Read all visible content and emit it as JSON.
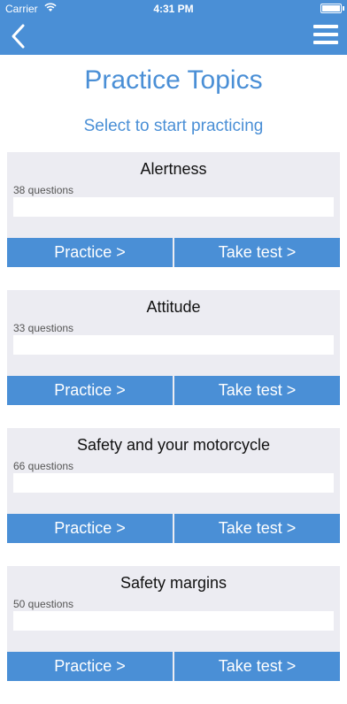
{
  "status_bar": {
    "carrier": "Carrier",
    "time": "4:31 PM"
  },
  "nav": {
    "back_icon": "chevron-left-icon",
    "menu_icon": "hamburger-menu-icon"
  },
  "header": {
    "title": "Practice Topics",
    "subtitle": "Select to start practicing"
  },
  "topics": [
    {
      "name": "Alertness",
      "count": "38 questions",
      "progress": 0,
      "practice_label": "Practice >",
      "test_label": "Take test >"
    },
    {
      "name": "Attitude",
      "count": "33 questions",
      "progress": 0,
      "practice_label": "Practice >",
      "test_label": "Take test >"
    },
    {
      "name": "Safety and your motorcycle",
      "count": "66 questions",
      "progress": 0,
      "practice_label": "Practice >",
      "test_label": "Take test >"
    },
    {
      "name": "Safety margins",
      "count": "50 questions",
      "progress": 0,
      "practice_label": "Practice >",
      "test_label": "Take test >"
    }
  ],
  "colors": {
    "accent": "#4a8fd6",
    "card_bg": "#ececf2"
  }
}
